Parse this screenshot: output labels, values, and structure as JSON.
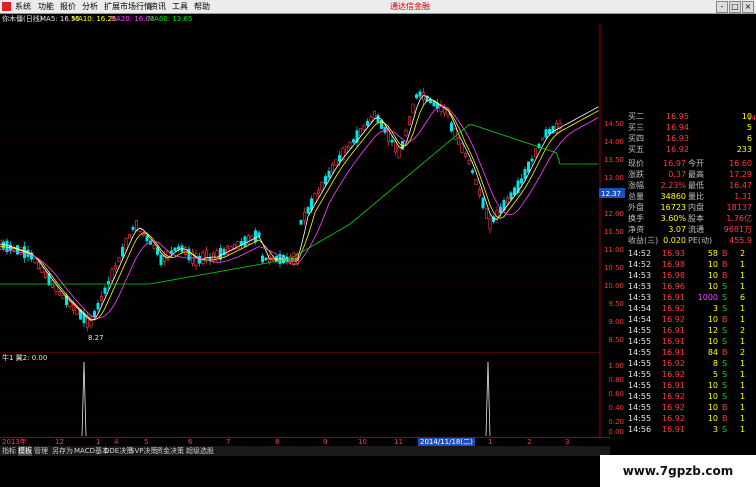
{
  "menu": {
    "items": [
      "系统",
      "功能",
      "报价",
      "分析",
      "扩展市场行情",
      "资讯",
      "工具",
      "帮助"
    ],
    "banner": "通达信金融",
    "window_buttons": [
      "-",
      "□",
      "×"
    ]
  },
  "ma_bar": {
    "name": "你木僵(日线)",
    "ma5": "MA5: 16.55",
    "ma10": "MA10: 16.25",
    "ma20": "MA20: 16.03",
    "ma60": "MA60: 13.65"
  },
  "colors": {
    "ma5": "#ffffff",
    "ma10": "#ffff00",
    "ma20": "#ff44ff",
    "ma60": "#00e000",
    "up": "#ff3b3b",
    "down": "#00e5e5"
  },
  "price_axis": {
    "left": [
      "14.50",
      "14.00",
      "13.50",
      "13.00",
      "12.50",
      "12.00",
      "11.50",
      "11.00",
      "10.50",
      "10.00",
      "9.50",
      "9.00",
      "8.50"
    ],
    "right": [
      "14",
      "13.8",
      "13.5",
      "13",
      "12.5",
      "12",
      "11.5",
      "11.0",
      "10.5",
      "10",
      "9.5",
      "9.0",
      "8.5"
    ],
    "current": "12.37",
    "low_label": "8.27"
  },
  "sub_chart": {
    "label": "牛1 翼2: 0.00",
    "axis": [
      "1.00",
      "0.80",
      "0.60",
      "0.40",
      "0.20",
      "0.00"
    ],
    "spikes": [
      {
        "index": 20
      },
      {
        "index": 120
      }
    ]
  },
  "quote": {
    "levels": [
      {
        "label": "买二",
        "price": "16.95",
        "vol": "10"
      },
      {
        "label": "买三",
        "price": "16.94",
        "vol": "5"
      },
      {
        "label": "买四",
        "price": "16.93",
        "vol": "6"
      },
      {
        "label": "买五",
        "price": "16.92",
        "vol": "233"
      }
    ],
    "stats": [
      {
        "l1": "现价",
        "v1": "16.97",
        "l2": "今开",
        "v2": "16.60"
      },
      {
        "l1": "涨跌",
        "v1": "0.37",
        "l2": "最高",
        "v2": "17.29"
      },
      {
        "l1": "涨幅",
        "v1": "2.23%",
        "l2": "最低",
        "v2": "16.47"
      },
      {
        "l1": "总量",
        "v1": "34860",
        "l2": "量比",
        "v2": "1.31"
      },
      {
        "l1": "外盘",
        "v1": "16723",
        "l2": "内盘",
        "v2": "18137"
      },
      {
        "l1": "换手",
        "v1": "3.60%",
        "l2": "股本",
        "v2": "1.76亿"
      },
      {
        "l1": "净资",
        "v1": "3.07",
        "l2": "流通",
        "v2": "9681万"
      },
      {
        "l1": "收益(三)",
        "v1": "0.020",
        "l2": "PE(动)",
        "v2": "455.9"
      }
    ],
    "ticks": [
      {
        "time": "14:52",
        "price": "16.93",
        "vol": "58",
        "bs": "B",
        "num": "2"
      },
      {
        "time": "14:52",
        "price": "16.98",
        "vol": "10",
        "bs": "B",
        "num": "1"
      },
      {
        "time": "14:53",
        "price": "16.98",
        "vol": "10",
        "bs": "B",
        "num": "1"
      },
      {
        "time": "14:53",
        "price": "16.96",
        "vol": "10",
        "bs": "S",
        "num": "1"
      },
      {
        "time": "14:53",
        "price": "16.91",
        "vol": "1000",
        "bs": "S",
        "num": "6"
      },
      {
        "time": "14:54",
        "price": "16.92",
        "vol": "3",
        "bs": "S",
        "num": "1"
      },
      {
        "time": "14:54",
        "price": "16.92",
        "vol": "10",
        "bs": "B",
        "num": "1"
      },
      {
        "time": "14:55",
        "price": "16.91",
        "vol": "12",
        "bs": "S",
        "num": "2"
      },
      {
        "time": "14:55",
        "price": "16.91",
        "vol": "10",
        "bs": "S",
        "num": "1"
      },
      {
        "time": "14:55",
        "price": "16.91",
        "vol": "84",
        "bs": "B",
        "num": "2"
      },
      {
        "time": "14:55",
        "price": "16.92",
        "vol": "8",
        "bs": "S",
        "num": "1"
      },
      {
        "time": "14:55",
        "price": "16.92",
        "vol": "5",
        "bs": "S",
        "num": "1"
      },
      {
        "time": "14:55",
        "price": "16.91",
        "vol": "10",
        "bs": "S",
        "num": "1"
      },
      {
        "time": "14:55",
        "price": "16.92",
        "vol": "10",
        "bs": "S",
        "num": "1"
      },
      {
        "time": "14:55",
        "price": "16.92",
        "vol": "10",
        "bs": "B",
        "num": "1"
      },
      {
        "time": "14:55",
        "price": "16.92",
        "vol": "10",
        "bs": "B",
        "num": "1"
      },
      {
        "time": "14:56",
        "price": "16.91",
        "vol": "3",
        "bs": "S",
        "num": "1"
      }
    ]
  },
  "date_axis": {
    "labels": [
      "2013年",
      "12",
      "1",
      "4",
      "5",
      "6",
      "7",
      "8",
      "9",
      "10",
      "11",
      "1",
      "2",
      "3"
    ],
    "cursor": "2014/11/18(二)"
  },
  "tabs": [
    "指标",
    "模板",
    "管理",
    "另存为",
    "MACD基本",
    "DDE决策",
    "SVP决策",
    "资金决策",
    "超级选股"
  ],
  "watermark": "www.7gpzb.com"
}
